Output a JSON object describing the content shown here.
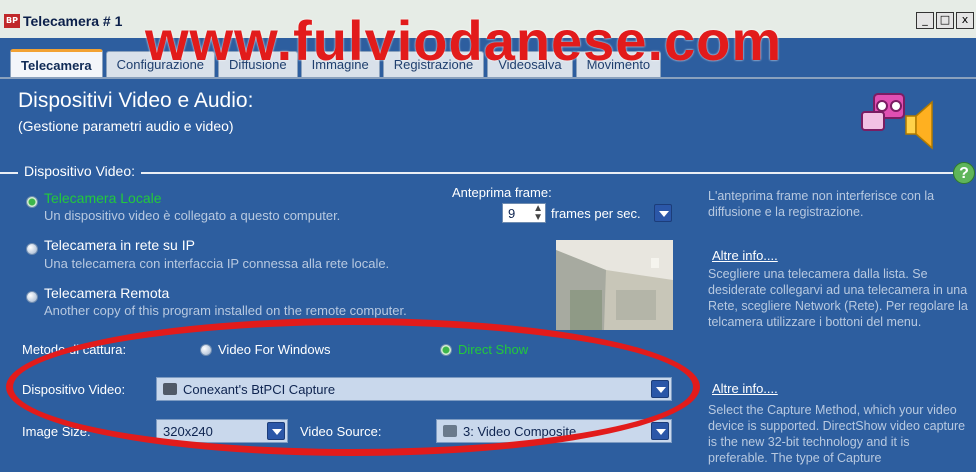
{
  "window": {
    "title": "Telecamera # 1",
    "app_icon_text": "BP",
    "controls": {
      "minimize": "_",
      "maximize": "□",
      "close": "x"
    }
  },
  "tabs": [
    {
      "label": "Telecamera",
      "active": true
    },
    {
      "label": "Configurazione",
      "active": false
    },
    {
      "label": "Diffusione",
      "active": false
    },
    {
      "label": "Immagine",
      "active": false
    },
    {
      "label": "Registrazione",
      "active": false
    },
    {
      "label": "Videosalva",
      "active": false
    },
    {
      "label": "Movimento",
      "active": false
    }
  ],
  "watermark": "www.fulviodanese.com",
  "header": {
    "title": "Dispositivi Video e Audio:",
    "subtitle": "(Gestione parametri audio e video)"
  },
  "section": {
    "label": "Dispositivo Video:",
    "help_icon": "?"
  },
  "options": [
    {
      "title": "Telecamera Locale",
      "desc": "Un dispositivo video è collegato a questo computer.",
      "selected": true
    },
    {
      "title": "Telecamera in rete su IP",
      "desc": "Una telecamera con interfaccia IP connessa alla rete locale.",
      "selected": false
    },
    {
      "title": "Telecamera Remota",
      "desc": "Another copy of this program installed on the remote computer.",
      "selected": false
    }
  ],
  "preview_frames": {
    "label": "Anteprima frame:",
    "value": "9",
    "unit": "frames per sec."
  },
  "capture_method": {
    "label": "Metodo di cattura:",
    "options": [
      {
        "label": "Video For Windows",
        "selected": false
      },
      {
        "label": "Direct Show",
        "selected": true
      }
    ]
  },
  "video_device": {
    "label": "Dispositivo Video:",
    "value": "Conexant's BtPCI Capture"
  },
  "image_size": {
    "label": "Image Size:",
    "value": "320x240"
  },
  "video_source": {
    "label": "Video Source:",
    "value": "3: Video Composite"
  },
  "info_panel": {
    "preview_note": "L'anteprima frame non interferisce con la diffusione e la registrazione.",
    "link1": "Altre info....",
    "camera_note": "Scegliere una telecamera dalla lista. Se desiderate collegarvi ad una telecamera in una Rete, scegliere Network (Rete). Per regolare la telcamera utilizzare i bottoni del menu.",
    "link2": "Altre info....",
    "capture_note": "Select the Capture Method, which your video device is supported. DirectShow video capture is the new 32-bit technology and it is preferable. The type of Capture"
  },
  "colors": {
    "background": "#2d5e9f",
    "watermark": "#e21b1b",
    "selected_text": "#22c93b"
  }
}
